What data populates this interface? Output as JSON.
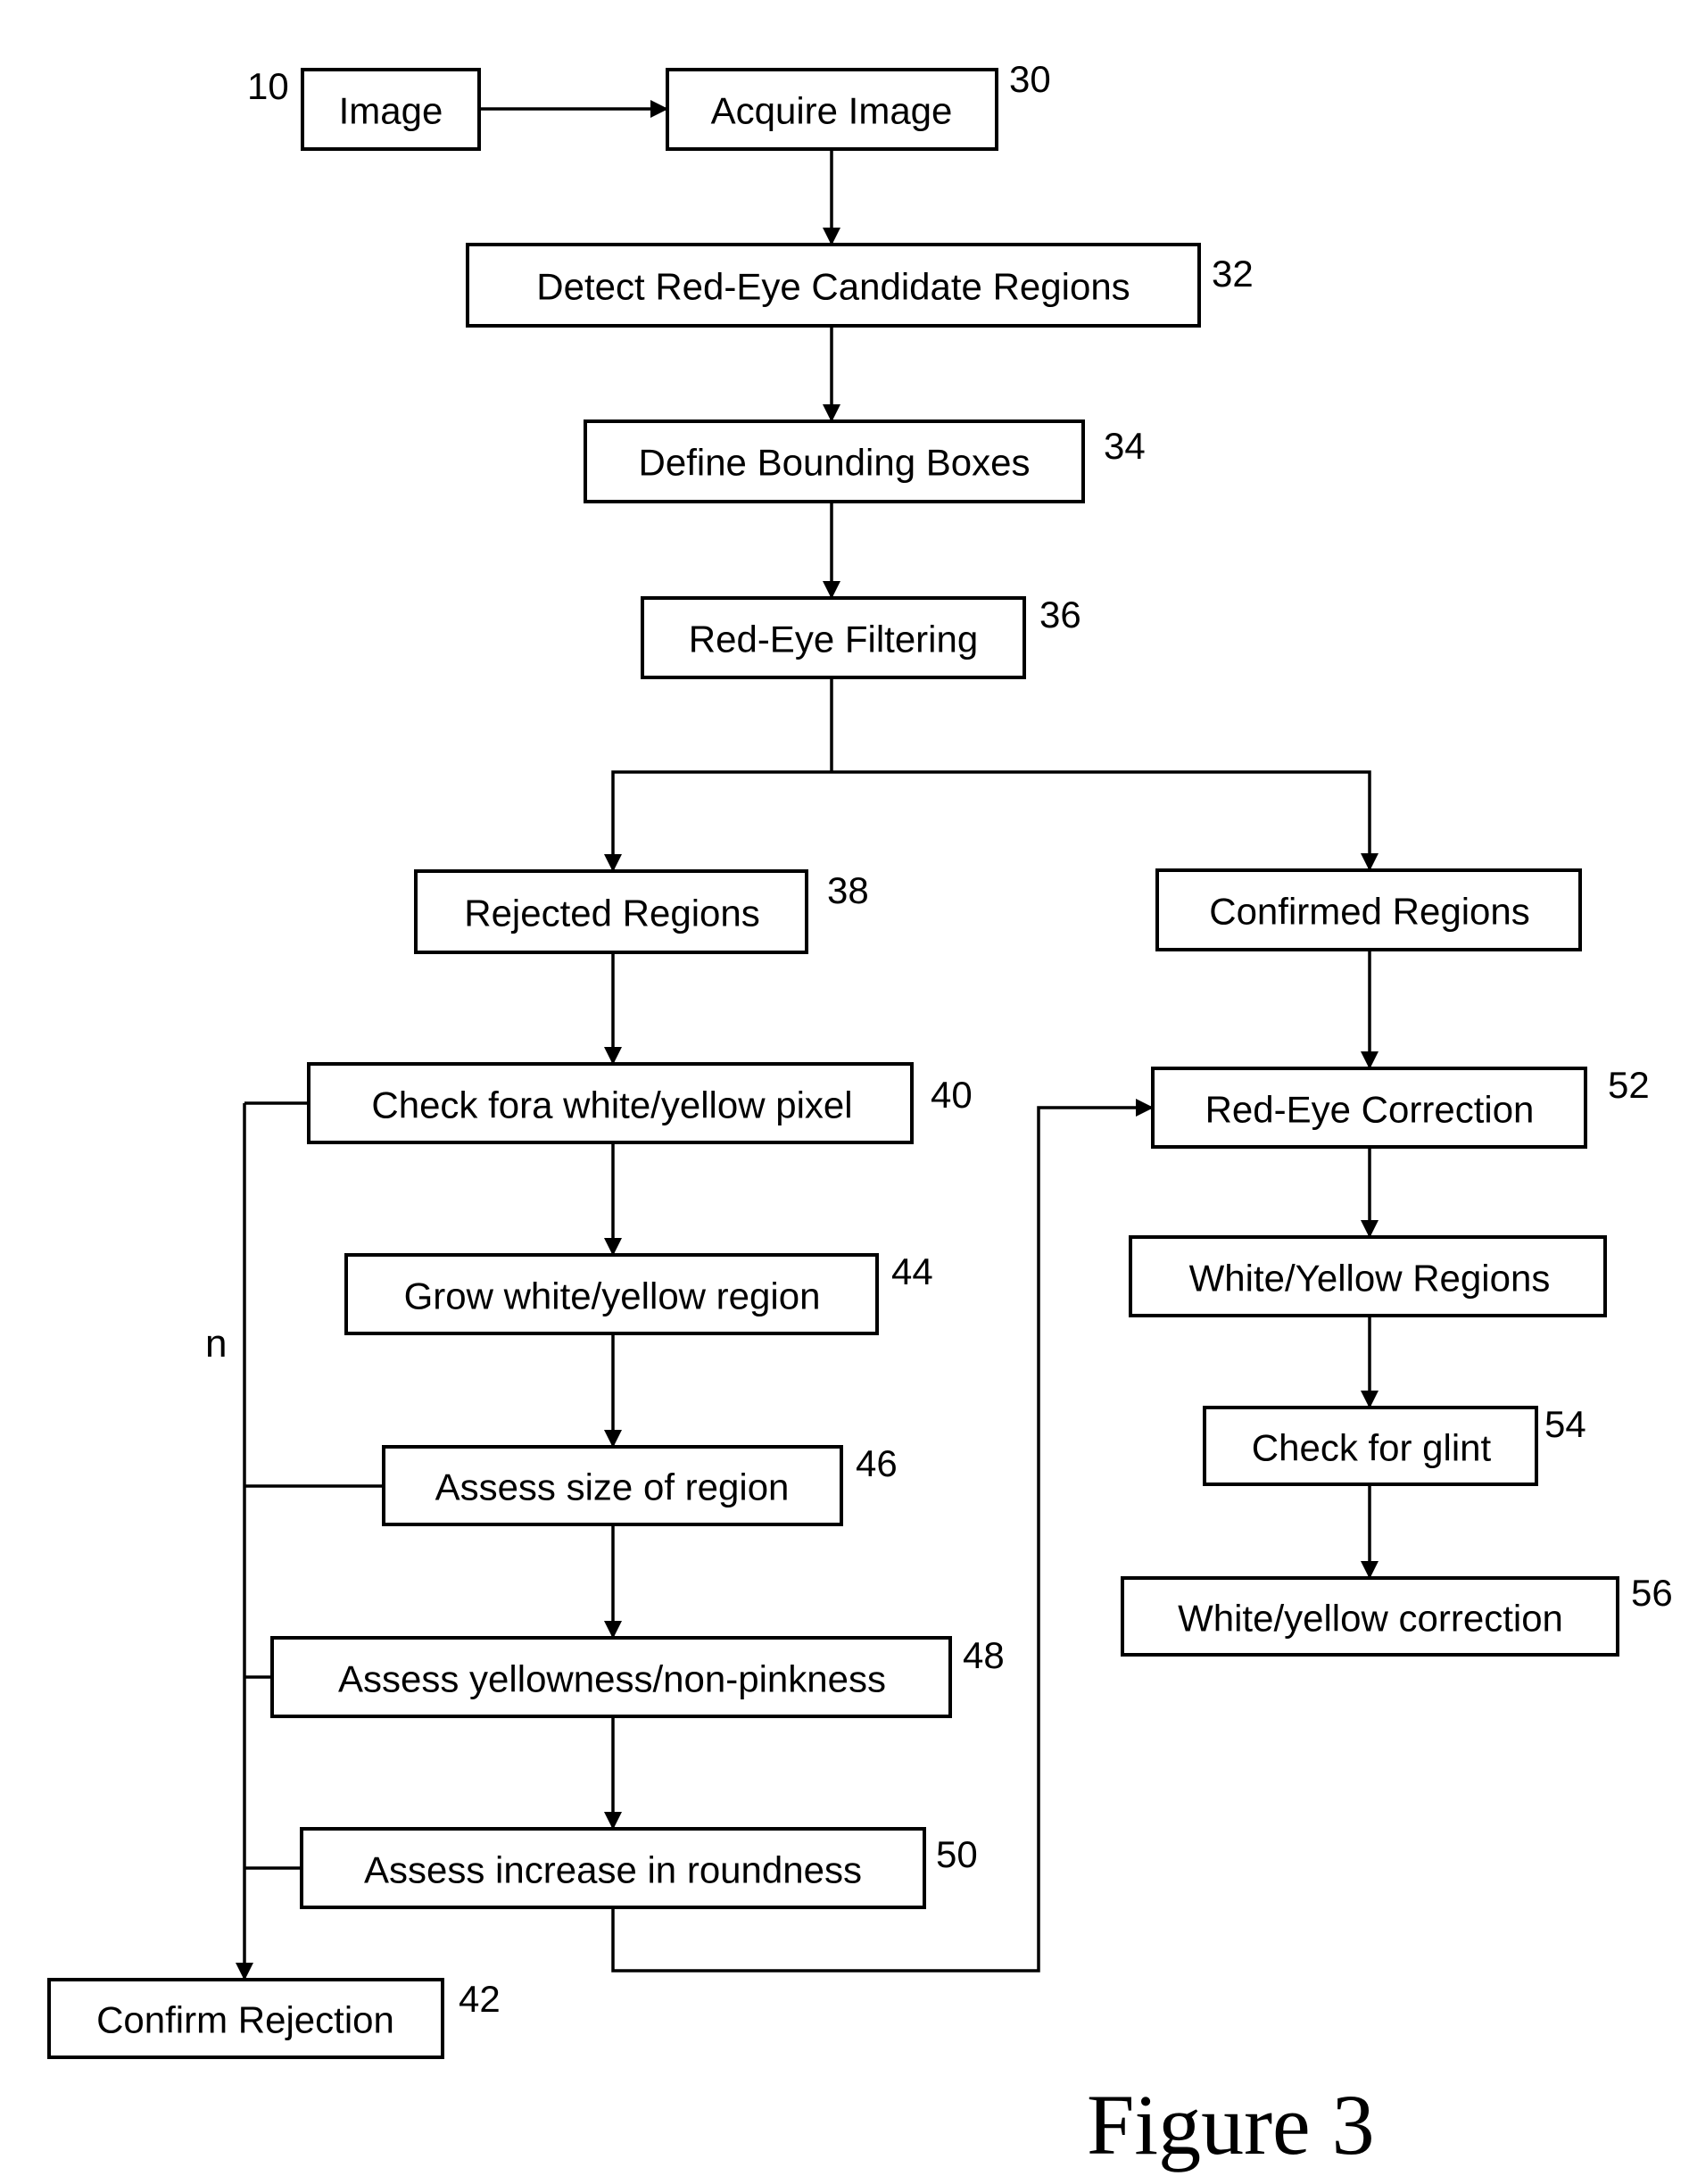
{
  "figure": {
    "caption": "Figure 3",
    "branch_label": "n"
  },
  "nodes": {
    "image": {
      "label": "Image",
      "ref": "10"
    },
    "acquire_image": {
      "label": "Acquire Image",
      "ref": "30"
    },
    "detect_candidates": {
      "label": "Detect Red-Eye Candidate Regions",
      "ref": "32"
    },
    "define_bounding_boxes": {
      "label": "Define Bounding Boxes",
      "ref": "34"
    },
    "red_eye_filtering": {
      "label": "Red-Eye Filtering",
      "ref": "36"
    },
    "rejected_regions": {
      "label": "Rejected Regions",
      "ref": "38"
    },
    "confirmed_regions": {
      "label": "Confirmed Regions",
      "ref": ""
    },
    "check_white_yellow_pixel": {
      "label": "Check fora white/yellow pixel",
      "ref": "40"
    },
    "grow_region": {
      "label": "Grow white/yellow region",
      "ref": "44"
    },
    "assess_size": {
      "label": "Assess size of region",
      "ref": "46"
    },
    "assess_yellowness": {
      "label": "Assess yellowness/non-pinkness",
      "ref": "48"
    },
    "assess_roundness": {
      "label": "Assess increase in roundness",
      "ref": "50"
    },
    "confirm_rejection": {
      "label": "Confirm Rejection",
      "ref": "42"
    },
    "red_eye_correction": {
      "label": "Red-Eye Correction",
      "ref": "52"
    },
    "white_yellow_regions": {
      "label": "White/Yellow Regions",
      "ref": ""
    },
    "check_glint": {
      "label": "Check for glint",
      "ref": "54"
    },
    "white_yellow_correction": {
      "label": "White/yellow correction",
      "ref": "56"
    }
  },
  "edges": [
    {
      "from": "image",
      "to": "acquire_image"
    },
    {
      "from": "acquire_image",
      "to": "detect_candidates"
    },
    {
      "from": "detect_candidates",
      "to": "define_bounding_boxes"
    },
    {
      "from": "define_bounding_boxes",
      "to": "red_eye_filtering"
    },
    {
      "from": "red_eye_filtering",
      "to": "rejected_regions"
    },
    {
      "from": "red_eye_filtering",
      "to": "confirmed_regions"
    },
    {
      "from": "rejected_regions",
      "to": "check_white_yellow_pixel"
    },
    {
      "from": "check_white_yellow_pixel",
      "to": "grow_region"
    },
    {
      "from": "grow_region",
      "to": "assess_size"
    },
    {
      "from": "assess_size",
      "to": "assess_yellowness"
    },
    {
      "from": "assess_yellowness",
      "to": "assess_roundness"
    },
    {
      "from": "assess_roundness",
      "to": "red_eye_correction"
    },
    {
      "from": "check_white_yellow_pixel",
      "to": "confirm_rejection",
      "label": "n"
    },
    {
      "from": "assess_size",
      "to": "confirm_rejection",
      "label": "n"
    },
    {
      "from": "assess_yellowness",
      "to": "confirm_rejection",
      "label": "n"
    },
    {
      "from": "assess_roundness",
      "to": "confirm_rejection",
      "label": "n"
    },
    {
      "from": "confirmed_regions",
      "to": "red_eye_correction"
    },
    {
      "from": "red_eye_correction",
      "to": "white_yellow_regions"
    },
    {
      "from": "white_yellow_regions",
      "to": "check_glint"
    },
    {
      "from": "check_glint",
      "to": "white_yellow_correction"
    }
  ]
}
